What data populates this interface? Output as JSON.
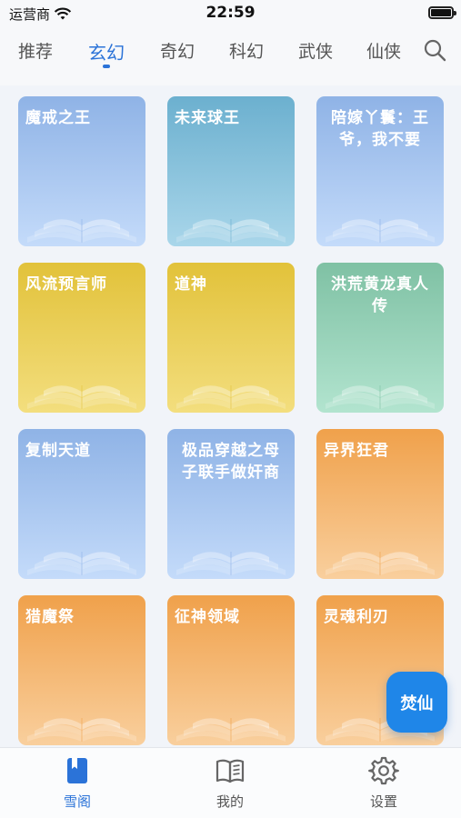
{
  "status": {
    "carrier": "运营商",
    "time": "22:59"
  },
  "tabs": [
    "推荐",
    "玄幻",
    "奇幻",
    "科幻",
    "武侠",
    "仙侠"
  ],
  "active_tab": "玄幻",
  "books": [
    {
      "title": "魔戒之王",
      "color_top": "#8fb3e6",
      "color_bottom": "#c4dbfa"
    },
    {
      "title": "未来球王",
      "color_top": "#6cb0cf",
      "color_bottom": "#a9d6ea"
    },
    {
      "title": "陪嫁丫鬟：王爷，我不要",
      "color_top": "#8fb3e6",
      "color_bottom": "#c4dbfa"
    },
    {
      "title": "风流预言师",
      "color_top": "#e2c23a",
      "color_bottom": "#f3de7e"
    },
    {
      "title": "道神",
      "color_top": "#e2c23a",
      "color_bottom": "#f3de7e"
    },
    {
      "title": "洪荒黄龙真人传",
      "color_top": "#7fc1a4",
      "color_bottom": "#b2e4cf"
    },
    {
      "title": "复制天道",
      "color_top": "#8fb3e6",
      "color_bottom": "#c4dbfa"
    },
    {
      "title": "极品穿越之母子联手做奸商",
      "color_top": "#8fb3e6",
      "color_bottom": "#c4dbfa"
    },
    {
      "title": "异界狂君",
      "color_top": "#f0a14b",
      "color_bottom": "#f9cf9d"
    },
    {
      "title": "猎魔祭",
      "color_top": "#f0a14b",
      "color_bottom": "#f9cf9d"
    },
    {
      "title": "征神领域",
      "color_top": "#f0a14b",
      "color_bottom": "#f9cf9d"
    },
    {
      "title": "灵魂利刃",
      "color_top": "#f0a14b",
      "color_bottom": "#f9cf9d"
    }
  ],
  "fab_label": "焚仙",
  "bottom_nav": [
    {
      "label": "雪阁",
      "icon": "bookmark-book-icon",
      "active": true
    },
    {
      "label": "我的",
      "icon": "open-book-icon",
      "active": false
    },
    {
      "label": "设置",
      "icon": "gear-icon",
      "active": false
    }
  ],
  "colors": {
    "accent": "#2b73d8",
    "fab": "#1f86e8"
  }
}
